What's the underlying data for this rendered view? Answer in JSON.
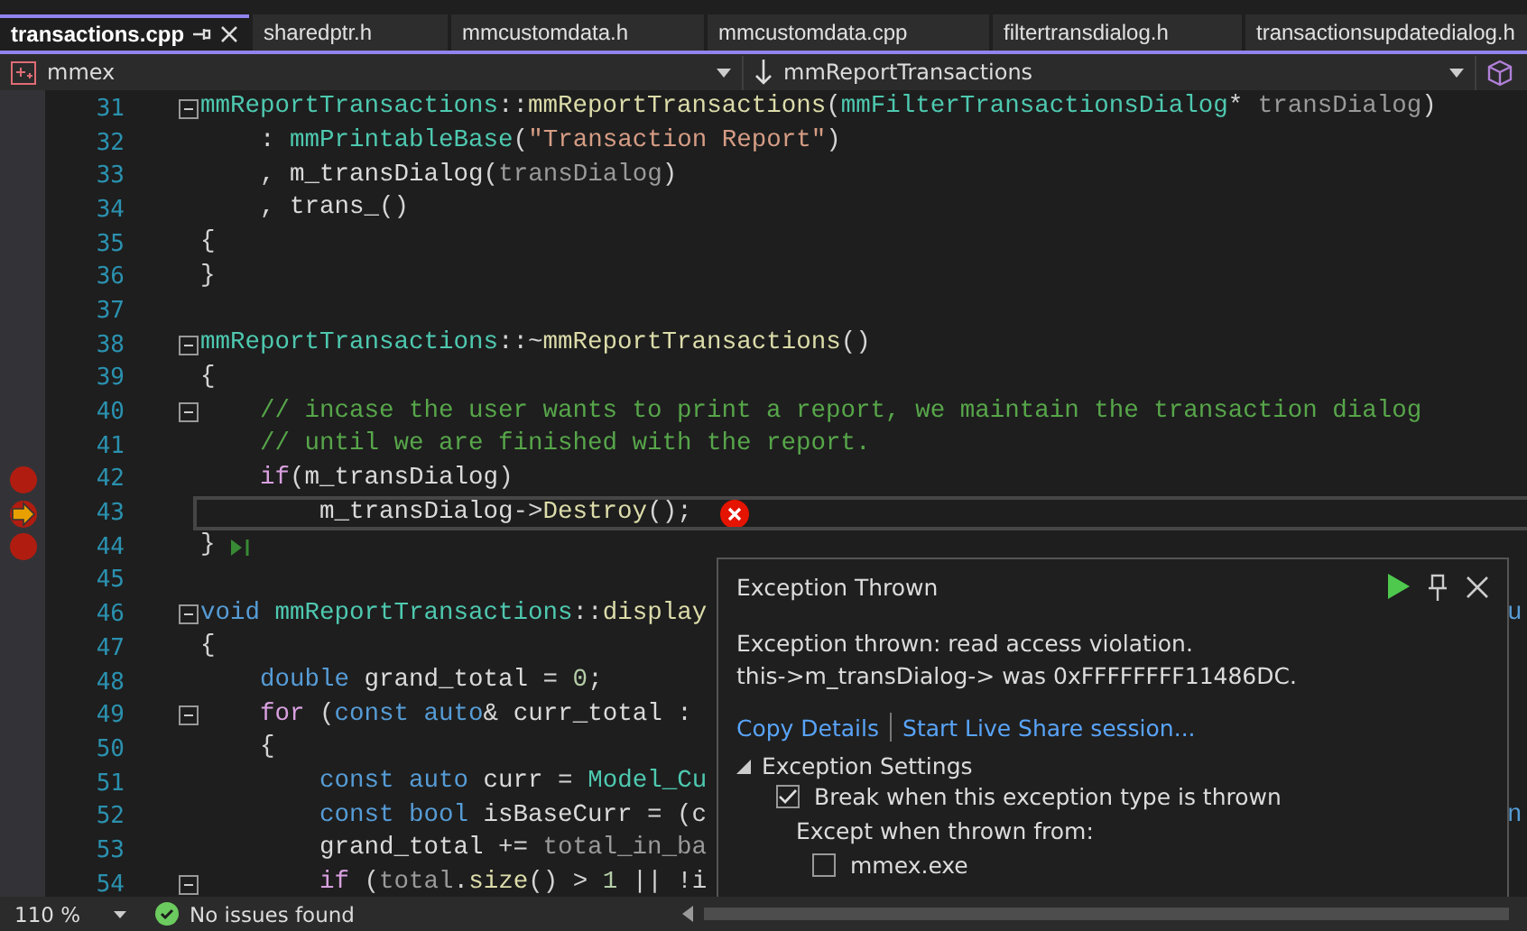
{
  "tabs": [
    {
      "label": "transactions.cpp",
      "selected": true
    },
    {
      "label": "sharedptr.h",
      "selected": false
    },
    {
      "label": "mmcustomdata.h",
      "selected": false
    },
    {
      "label": "mmcustomdata.cpp",
      "selected": false
    },
    {
      "label": "filtertransdialog.h",
      "selected": false
    },
    {
      "label": "transactionsupdatedialog.h",
      "selected": false
    }
  ],
  "nav": {
    "project": "mmex",
    "scope": "mmReportTransactions"
  },
  "code_lines": [
    {
      "n": "31",
      "breakpoint": false,
      "current": false,
      "fold": true,
      "tokens": [
        {
          "t": "mmReportTransactions",
          "color": "#4ec9b0"
        },
        {
          "t": "::",
          "color": "#d4d4d4"
        },
        {
          "t": "mmReportTransactions",
          "color": "#dcdcaa"
        },
        {
          "t": "(",
          "color": "#d4d4d4"
        },
        {
          "t": "mmFilterTransactionsDialog",
          "color": "#4ec9b0"
        },
        {
          "t": "* ",
          "color": "#d4d4d4"
        },
        {
          "t": "transDialog",
          "color": "#9a9a9a"
        },
        {
          "t": ")",
          "color": "#d4d4d4"
        }
      ]
    },
    {
      "n": "32",
      "breakpoint": false,
      "current": false,
      "fold": false,
      "tokens": [
        {
          "t": "    : ",
          "color": "#d4d4d4"
        },
        {
          "t": "mmPrintableBase",
          "color": "#4ec9b0"
        },
        {
          "t": "(",
          "color": "#d4d4d4"
        },
        {
          "t": "\"Transaction Report\"",
          "color": "#d69d85"
        },
        {
          "t": ")",
          "color": "#d4d4d4"
        }
      ]
    },
    {
      "n": "33",
      "breakpoint": false,
      "current": false,
      "fold": false,
      "tokens": [
        {
          "t": "    , ",
          "color": "#d4d4d4"
        },
        {
          "t": "m_transDialog",
          "color": "#dadada"
        },
        {
          "t": "(",
          "color": "#d4d4d4"
        },
        {
          "t": "transDialog",
          "color": "#9a9a9a"
        },
        {
          "t": ")",
          "color": "#d4d4d4"
        }
      ]
    },
    {
      "n": "34",
      "breakpoint": false,
      "current": false,
      "fold": false,
      "tokens": [
        {
          "t": "    , ",
          "color": "#d4d4d4"
        },
        {
          "t": "trans_",
          "color": "#dadada"
        },
        {
          "t": "()",
          "color": "#d4d4d4"
        }
      ]
    },
    {
      "n": "35",
      "breakpoint": false,
      "current": false,
      "fold": false,
      "tokens": [
        {
          "t": "{",
          "color": "#d4d4d4"
        }
      ]
    },
    {
      "n": "36",
      "breakpoint": false,
      "current": false,
      "fold": false,
      "tokens": [
        {
          "t": "}",
          "color": "#d4d4d4"
        }
      ]
    },
    {
      "n": "37",
      "breakpoint": false,
      "current": false,
      "fold": false
    },
    {
      "n": "38",
      "breakpoint": false,
      "current": false,
      "fold": true,
      "tokens": [
        {
          "t": "mmReportTransactions",
          "color": "#4ec9b0"
        },
        {
          "t": "::~",
          "color": "#d4d4d4"
        },
        {
          "t": "mmReportTransactions",
          "color": "#dcdcaa"
        },
        {
          "t": "()",
          "color": "#d4d4d4"
        }
      ]
    },
    {
      "n": "39",
      "breakpoint": false,
      "current": false,
      "fold": false,
      "tokens": [
        {
          "t": "{",
          "color": "#d4d4d4"
        }
      ]
    },
    {
      "n": "40",
      "breakpoint": false,
      "current": false,
      "fold": true,
      "tokens": [
        {
          "t": "    // incase the user wants to print a report, we maintain the transaction dialog",
          "color": "#57a64a"
        }
      ]
    },
    {
      "n": "41",
      "breakpoint": false,
      "current": false,
      "fold": false,
      "tokens": [
        {
          "t": "    // until we are finished with the report.",
          "color": "#57a64a"
        }
      ]
    },
    {
      "n": "42",
      "breakpoint": true,
      "current": false,
      "fold": false,
      "tokens": [
        {
          "t": "    if",
          "color": "#d8a0df"
        },
        {
          "t": "(",
          "color": "#d4d4d4"
        },
        {
          "t": "m_transDialog",
          "color": "#dadada"
        },
        {
          "t": ")",
          "color": "#d4d4d4"
        }
      ]
    },
    {
      "n": "43",
      "breakpoint": true,
      "current": true,
      "fold": false,
      "error": true,
      "tokens": [
        {
          "t": "        m_transDialog",
          "color": "#dadada"
        },
        {
          "t": "->",
          "color": "#d4d4d4"
        },
        {
          "t": "Destroy",
          "color": "#dcdcaa"
        },
        {
          "t": "();",
          "color": "#d4d4d4"
        }
      ]
    },
    {
      "n": "44",
      "breakpoint": true,
      "current": false,
      "fold": false,
      "run_to_click": true,
      "tokens": [
        {
          "t": "}",
          "color": "#d4d4d4"
        }
      ]
    },
    {
      "n": "45",
      "breakpoint": false,
      "current": false,
      "fold": false
    },
    {
      "n": "46",
      "breakpoint": false,
      "current": false,
      "fold": true,
      "tail": "u",
      "tokens": [
        {
          "t": "void ",
          "color": "#569cd6"
        },
        {
          "t": "mmReportTransactions",
          "color": "#4ec9b0"
        },
        {
          "t": "::",
          "color": "#d4d4d4"
        },
        {
          "t": "display",
          "color": "#dcdcaa"
        }
      ]
    },
    {
      "n": "47",
      "breakpoint": false,
      "current": false,
      "fold": false,
      "tokens": [
        {
          "t": "{",
          "color": "#d4d4d4"
        }
      ]
    },
    {
      "n": "48",
      "breakpoint": false,
      "current": false,
      "fold": false,
      "tokens": [
        {
          "t": "    double ",
          "color": "#569cd6"
        },
        {
          "t": "grand_total",
          "color": "#dadada"
        },
        {
          "t": " = ",
          "color": "#d4d4d4"
        },
        {
          "t": "0",
          "color": "#b5cea8"
        },
        {
          "t": ";",
          "color": "#d4d4d4"
        }
      ]
    },
    {
      "n": "49",
      "breakpoint": false,
      "current": false,
      "fold": true,
      "tokens": [
        {
          "t": "    for",
          "color": "#d8a0df"
        },
        {
          "t": " (",
          "color": "#d4d4d4"
        },
        {
          "t": "const auto",
          "color": "#569cd6"
        },
        {
          "t": "& ",
          "color": "#d4d4d4"
        },
        {
          "t": "curr_total",
          "color": "#dadada"
        },
        {
          "t": " :",
          "color": "#d4d4d4"
        }
      ]
    },
    {
      "n": "50",
      "breakpoint": false,
      "current": false,
      "fold": false,
      "tokens": [
        {
          "t": "    {",
          "color": "#d4d4d4"
        }
      ]
    },
    {
      "n": "51",
      "breakpoint": false,
      "current": false,
      "fold": false,
      "tokens": [
        {
          "t": "        const auto ",
          "color": "#569cd6"
        },
        {
          "t": "curr",
          "color": "#dadada"
        },
        {
          "t": " = ",
          "color": "#d4d4d4"
        },
        {
          "t": "Model_Cu",
          "color": "#4ec9b0"
        }
      ]
    },
    {
      "n": "52",
      "breakpoint": false,
      "current": false,
      "fold": false,
      "tail": "n",
      "tokens": [
        {
          "t": "        const bool ",
          "color": "#569cd6"
        },
        {
          "t": "isBaseCurr",
          "color": "#dadada"
        },
        {
          "t": " = (c",
          "color": "#d4d4d4"
        }
      ]
    },
    {
      "n": "53",
      "breakpoint": false,
      "current": false,
      "fold": false,
      "tokens": [
        {
          "t": "        grand_total",
          "color": "#dadada"
        },
        {
          "t": " += ",
          "color": "#d4d4d4"
        },
        {
          "t": "total_in_ba",
          "color": "#9a9a9a"
        }
      ]
    },
    {
      "n": "54",
      "breakpoint": false,
      "current": false,
      "fold": true,
      "tokens": [
        {
          "t": "        if",
          "color": "#d8a0df"
        },
        {
          "t": " (",
          "color": "#d4d4d4"
        },
        {
          "t": "total",
          "color": "#9a9a9a"
        },
        {
          "t": ".",
          "color": "#d4d4d4"
        },
        {
          "t": "size",
          "color": "#dcdcaa"
        },
        {
          "t": "() > ",
          "color": "#d4d4d4"
        },
        {
          "t": "1",
          "color": "#b5cea8"
        },
        {
          "t": " || !i",
          "color": "#d4d4d4"
        }
      ]
    }
  ],
  "exception": {
    "title": "Exception Thrown",
    "message": [
      "Exception thrown: read access violation.",
      "this->m_transDialog-> was 0xFFFFFFFF11486DC."
    ],
    "links": [
      "Copy Details",
      "Start Live Share session..."
    ],
    "settings": {
      "label": "Exception Settings",
      "expanded": true,
      "options": [
        {
          "label": "Break when this exception type is thrown",
          "checked": true
        }
      ],
      "except_caption": "Except when thrown from:",
      "except_modules": [
        {
          "label": "mmex.exe",
          "checked": false
        }
      ]
    }
  },
  "status_bar": {
    "zoom": "110 %",
    "issues": "No issues found"
  }
}
